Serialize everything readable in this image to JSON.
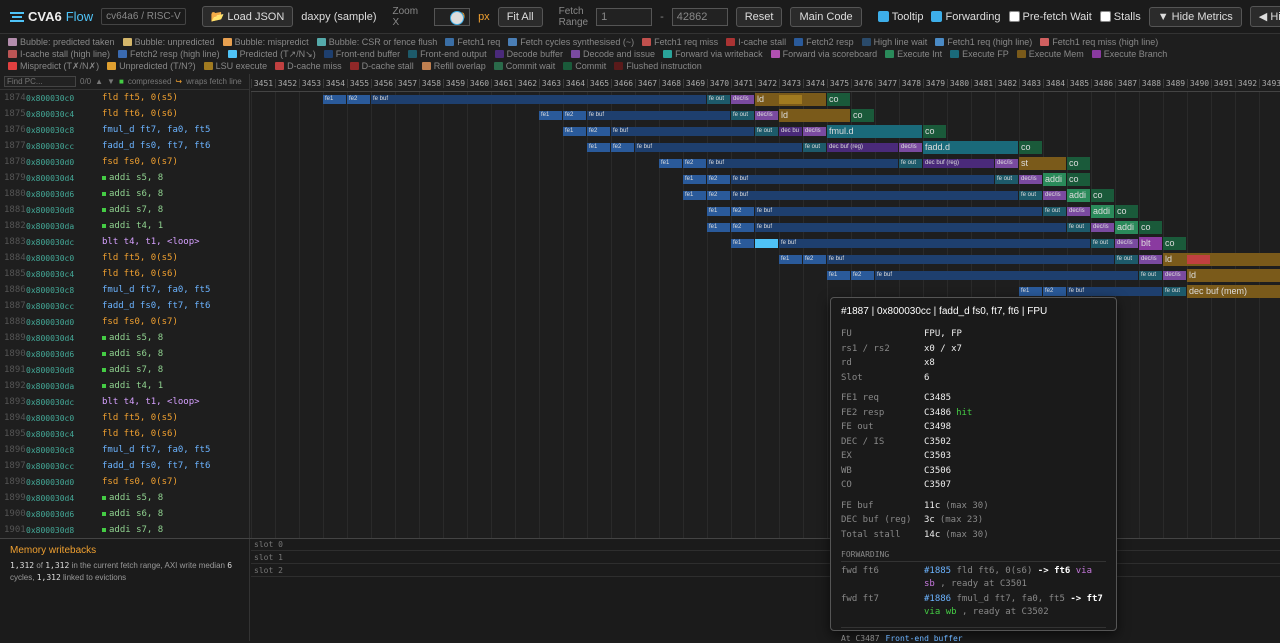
{
  "app": {
    "name": "CVA6",
    "name_suffix": "Flow",
    "isa": "cv64a6 / RISC-V"
  },
  "toolbar": {
    "load_label": "Load JSON",
    "file": "daxpy (sample)",
    "zoom_label": "Zoom X",
    "zoom_value": "30",
    "zoom_unit": "px",
    "fit_label": "Fit All",
    "range_label": "Fetch Range",
    "range_from": "1",
    "range_to": "42862",
    "range_dash": "-",
    "reset_label": "Reset",
    "main_code_label": "Main Code",
    "tooltip_label": "Tooltip",
    "tooltip_on": true,
    "forwarding_label": "Forwarding",
    "forwarding_on": true,
    "prefetch_label": "Pre-fetch Wait",
    "prefetch_on": false,
    "stalls_label": "Stalls",
    "stalls_on": false,
    "hide_metrics_label": "Hide Metrics",
    "hide_labels_label": "Hide Labels"
  },
  "legend": [
    {
      "label": "Bubble: predicted taken",
      "color": "#b48ead"
    },
    {
      "label": "Bubble: unpredicted",
      "color": "#d4b66a"
    },
    {
      "label": "Bubble: mispredict",
      "color": "#e8a050"
    },
    {
      "label": "Bubble: CSR or fence flush",
      "color": "#5aa"
    },
    {
      "label": "Fetch1 req",
      "color": "#3a6ea5"
    },
    {
      "label": "Fetch cycles synthesised (~)",
      "color": "#4a7eb5"
    },
    {
      "label": "Fetch1 req miss",
      "color": "#c0504d"
    },
    {
      "label": "I-cache stall",
      "color": "#a33"
    },
    {
      "label": "Fetch2 resp",
      "color": "#2a5a9a"
    },
    {
      "label": "High line wait",
      "color": "#2a4a6a"
    },
    {
      "label": "Fetch1 req (high line)",
      "color": "#4a8ac5"
    },
    {
      "label": "Fetch1 req miss (high line)",
      "color": "#d06060"
    },
    {
      "label": "I-cache stall (high line)",
      "color": "#b55"
    },
    {
      "label": "Fetch2 resp (high line)",
      "color": "#3a6ab0"
    },
    {
      "label": "Predicted (T↗/N↘)",
      "color": "#4fc3f7"
    },
    {
      "label": "Front-end buffer",
      "color": "#1e3f6e"
    },
    {
      "label": "Front-end output",
      "color": "#1d5a6a"
    },
    {
      "label": "Decode buffer",
      "color": "#4a2a7a"
    },
    {
      "label": "Decode and issue",
      "color": "#7a4aa0"
    },
    {
      "label": "Forward via writeback",
      "color": "#2aa39a"
    },
    {
      "label": "Forward via scoreboard",
      "color": "#b050b0"
    },
    {
      "label": "Execute Int",
      "color": "#2a8a5a"
    },
    {
      "label": "Execute FP",
      "color": "#1a6a7a"
    },
    {
      "label": "Execute Mem",
      "color": "#7a5a1a"
    },
    {
      "label": "Execute Branch",
      "color": "#8a3aa0"
    },
    {
      "label": "Mispredict (T✗/N✗)",
      "color": "#e04040"
    },
    {
      "label": "Unpredicted (T/N?)",
      "color": "#e0a030"
    },
    {
      "label": "LSU execute",
      "color": "#a07a20"
    },
    {
      "label": "D-cache miss",
      "color": "#c04040"
    },
    {
      "label": "D-cache stall",
      "color": "#902828"
    },
    {
      "label": "Refill overlap",
      "color": "#c08050"
    },
    {
      "label": "Commit wait",
      "color": "#2a6a4a"
    },
    {
      "label": "Commit",
      "color": "#1a5a3a"
    },
    {
      "label": "Flushed instruction",
      "color": "#5a1a1a"
    }
  ],
  "find": {
    "placeholder": "Find PC...",
    "count": "0/0",
    "compressed": "compressed",
    "wraps": "wraps fetch line"
  },
  "instructions": [
    {
      "n": "1874",
      "pc": "0x800030c0",
      "asm": "fld ft5, 0(s5)",
      "kind": "mem"
    },
    {
      "n": "1875",
      "pc": "0x800030c4",
      "asm": "fld ft6, 0(s6)",
      "kind": "mem"
    },
    {
      "n": "1876",
      "pc": "0x800030c8",
      "asm": "fmul_d ft7, fa0, ft5",
      "kind": "fp"
    },
    {
      "n": "1877",
      "pc": "0x800030cc",
      "asm": "fadd_d fs0, ft7, ft6",
      "kind": "fp"
    },
    {
      "n": "1878",
      "pc": "0x800030d0",
      "asm": "fsd fs0, 0(s7)",
      "kind": "mem"
    },
    {
      "n": "1879",
      "pc": "0x800030d4",
      "asm": "addi s5, 8",
      "kind": "int"
    },
    {
      "n": "1880",
      "pc": "0x800030d6",
      "asm": "addi s6, 8",
      "kind": "int"
    },
    {
      "n": "1881",
      "pc": "0x800030d8",
      "asm": "addi s7, 8",
      "kind": "int"
    },
    {
      "n": "1882",
      "pc": "0x800030da",
      "asm": "addi t4, 1",
      "kind": "int"
    },
    {
      "n": "1883",
      "pc": "0x800030dc",
      "asm": "blt t4, t1, <loop>",
      "kind": "br"
    },
    {
      "n": "1884",
      "pc": "0x800030c0",
      "asm": "fld ft5, 0(s5)",
      "kind": "mem"
    },
    {
      "n": "1885",
      "pc": "0x800030c4",
      "asm": "fld ft6, 0(s6)",
      "kind": "mem"
    },
    {
      "n": "1886",
      "pc": "0x800030c8",
      "asm": "fmul_d ft7, fa0, ft5",
      "kind": "fp"
    },
    {
      "n": "1887",
      "pc": "0x800030cc",
      "asm": "fadd_d fs0, ft7, ft6",
      "kind": "fp"
    },
    {
      "n": "1888",
      "pc": "0x800030d0",
      "asm": "fsd fs0, 0(s7)",
      "kind": "mem"
    },
    {
      "n": "1889",
      "pc": "0x800030d4",
      "asm": "addi s5, 8",
      "kind": "int"
    },
    {
      "n": "1890",
      "pc": "0x800030d6",
      "asm": "addi s6, 8",
      "kind": "int"
    },
    {
      "n": "1891",
      "pc": "0x800030d8",
      "asm": "addi s7, 8",
      "kind": "int"
    },
    {
      "n": "1892",
      "pc": "0x800030da",
      "asm": "addi t4, 1",
      "kind": "int"
    },
    {
      "n": "1893",
      "pc": "0x800030dc",
      "asm": "blt t4, t1, <loop>",
      "kind": "br"
    },
    {
      "n": "1894",
      "pc": "0x800030c0",
      "asm": "fld ft5, 0(s5)",
      "kind": "mem"
    },
    {
      "n": "1895",
      "pc": "0x800030c4",
      "asm": "fld ft6, 0(s6)",
      "kind": "mem"
    },
    {
      "n": "1896",
      "pc": "0x800030c8",
      "asm": "fmul_d ft7, fa0, ft5",
      "kind": "fp"
    },
    {
      "n": "1897",
      "pc": "0x800030cc",
      "asm": "fadd_d fs0, ft7, ft6",
      "kind": "fp"
    },
    {
      "n": "1898",
      "pc": "0x800030d0",
      "asm": "fsd fs0, 0(s7)",
      "kind": "mem"
    },
    {
      "n": "1899",
      "pc": "0x800030d4",
      "asm": "addi s5, 8",
      "kind": "int"
    },
    {
      "n": "1900",
      "pc": "0x800030d6",
      "asm": "addi s6, 8",
      "kind": "int"
    },
    {
      "n": "1901",
      "pc": "0x800030d8",
      "asm": "addi s7, 8",
      "kind": "int"
    }
  ],
  "axis": {
    "first_cycle": 3451,
    "last_cycle": 3493
  },
  "kind_colors": {
    "mem": "#f0a030",
    "fp": "#6bb3ff",
    "int": "#8fd18f",
    "br": "#d6a0ff"
  },
  "stage_colors": {
    "fe1": "#2a5a9a",
    "fe2": "#2a5a9a",
    "febuf": "#1e3f6e",
    "feout": "#1d5a6a",
    "decbuf": "#4a2a7a",
    "decis": "#7a4aa0",
    "mem": "#7a5a1a",
    "fp": "#1a6a7a",
    "int": "#2a8a5a",
    "br": "#8a3aa0",
    "co": "#1a5a3a",
    "pred": "#4fc3f7",
    "lsu": "#a07a20",
    "miss": "#c04040"
  },
  "rows": [
    {
      "fe1": 3454,
      "fb_end": 3470,
      "fo": 3470,
      "dec": 3471,
      "ex": 3472,
      "exk": "mem",
      "ex_label": "ld",
      "ex_len": 3,
      "co": 3475
    },
    {
      "fe1": 3463,
      "fb_end": 3471,
      "fo": 3471,
      "dec": 3472,
      "ex": 3473,
      "exk": "mem",
      "ex_label": "ld",
      "ex_len": 3,
      "co": 3476
    },
    {
      "fe1": 3464,
      "fb_end": 3472,
      "fo": 3472,
      "db": 3473,
      "dec": 3474,
      "ex": 3475,
      "exk": "fp",
      "ex_label": "fmul.d",
      "ex_len": 4,
      "co": 3479
    },
    {
      "fe1": 3465,
      "fb_end": 3474,
      "fo": 3474,
      "db": 3475,
      "db_label": "dec buf (reg)",
      "dec": 3478,
      "ex": 3479,
      "exk": "fp",
      "ex_label": "fadd.d",
      "ex_len": 4,
      "co": 3483
    },
    {
      "fe1": 3468,
      "fb_end": 3478,
      "fo": 3478,
      "db": 3479,
      "db_label": "dec buf (reg)",
      "dec": 3482,
      "ex": 3483,
      "exk": "mem",
      "ex_label": "st",
      "ex_len": 2,
      "co": 3485
    },
    {
      "fe1": 3469,
      "fb_end": 3482,
      "fo": 3482,
      "dec": 3483,
      "ex": 3484,
      "exk": "int",
      "ex_label": "addi",
      "ex_len": 1,
      "co": 3485
    },
    {
      "fe1": 3469,
      "fb_end": 3483,
      "fo": 3483,
      "dec": 3484,
      "ex": 3485,
      "exk": "int",
      "ex_label": "addi",
      "ex_len": 1,
      "co": 3486
    },
    {
      "fe1": 3470,
      "fb_end": 3484,
      "fo": 3484,
      "dec": 3485,
      "ex": 3486,
      "exk": "int",
      "ex_label": "addi",
      "ex_len": 1,
      "co": 3487
    },
    {
      "fe1": 3470,
      "fb_end": 3485,
      "fo": 3485,
      "dec": 3486,
      "ex": 3487,
      "exk": "int",
      "ex_label": "addi",
      "ex_len": 1,
      "co": 3488
    },
    {
      "fe1": 3471,
      "fb_end": 3486,
      "fo": 3486,
      "dec": 3487,
      "ex": 3488,
      "exk": "br",
      "ex_label": "blt",
      "ex_len": 1,
      "co": 3489
    },
    {
      "fe1": 3473,
      "fb_end": 3487,
      "fo": 3487,
      "dec": 3488,
      "ex": 3489,
      "exk": "mem",
      "ex_label": "ld",
      "ex_len": 5,
      "co": 3494
    },
    {
      "fe1": 3475,
      "fb_end": 3488,
      "fo": 3488,
      "dec": 3489,
      "ex": 3490,
      "exk": "mem",
      "ex_label": "ld",
      "ex_len": 4,
      "co": 3494
    },
    {
      "fe1": 3483,
      "fb_end": 3489,
      "fo": 3489,
      "dec": 3490,
      "ex": 3490,
      "exk": "mem",
      "ex_label": "dec buf (mem)",
      "ex_len": 4,
      "co": 3494
    }
  ],
  "tooltip": {
    "title": "#1887 | 0x800030cc | fadd_d fs0, ft7, ft6 | FPU",
    "fields": [
      {
        "k": "FU",
        "v": "FPU, FP"
      },
      {
        "k": "rs1 / rs2",
        "v": "x0 / x7"
      },
      {
        "k": "rd",
        "v": "x8"
      },
      {
        "k": "Slot",
        "v": "6"
      }
    ],
    "timing": [
      {
        "k": "FE1 req",
        "v": "C3485"
      },
      {
        "k": "FE2 resp",
        "v": "C3486",
        "extra": "hit"
      },
      {
        "k": "FE out",
        "v": "C3498"
      },
      {
        "k": "DEC / IS",
        "v": "C3502"
      },
      {
        "k": "EX",
        "v": "C3503"
      },
      {
        "k": "WB",
        "v": "C3506"
      },
      {
        "k": "CO",
        "v": "C3507"
      }
    ],
    "stalls": [
      {
        "k": "FE buf",
        "v": "11c",
        "extra": "(max 30)"
      },
      {
        "k": "DEC buf (reg)",
        "v": "3c",
        "extra": "(max 23)"
      },
      {
        "k": "Total stall",
        "v": "14c",
        "extra": "(max 30)"
      }
    ],
    "forwarding_label": "FORWARDING",
    "forwards": [
      {
        "k": "fwd ft6",
        "id": "#1885",
        "ins": "fld ft6, 0(s6)",
        "arrow": "->",
        "reg": "ft6",
        "via": "via",
        "path": "sb",
        "ready": ", ready at C3501"
      },
      {
        "k": "fwd ft7",
        "id": "#1886",
        "ins": "fmul_d ft7, fa0, ft5",
        "arrow": "->",
        "reg": "ft7",
        "via": "via",
        "path": "wb",
        "ready": ", ready at C3502"
      }
    ],
    "footer_at": "At C3487",
    "footer_stage": "Front-end buffer"
  },
  "memwb": {
    "title": "Memory writebacks",
    "count": "1,312",
    "of": "of",
    "total": "1,312",
    "text1": "in the current fetch range, AXI write median",
    "median": "6",
    "text2": "cycles,",
    "linked": "1,312",
    "text3": "linked to evictions"
  },
  "slots": [
    "slot 0",
    "slot 1",
    "slot 2"
  ]
}
